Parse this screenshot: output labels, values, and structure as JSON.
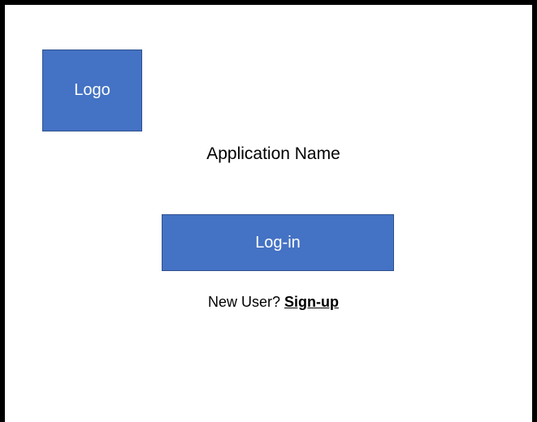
{
  "logo": {
    "label": "Logo"
  },
  "app": {
    "name": "Application Name"
  },
  "login": {
    "button_label": "Log-in"
  },
  "signup": {
    "prompt": "New User?",
    "link_label": "Sign-up"
  },
  "colors": {
    "accent": "#4472c4",
    "accent_border": "#2f528f",
    "frame": "#000000"
  }
}
